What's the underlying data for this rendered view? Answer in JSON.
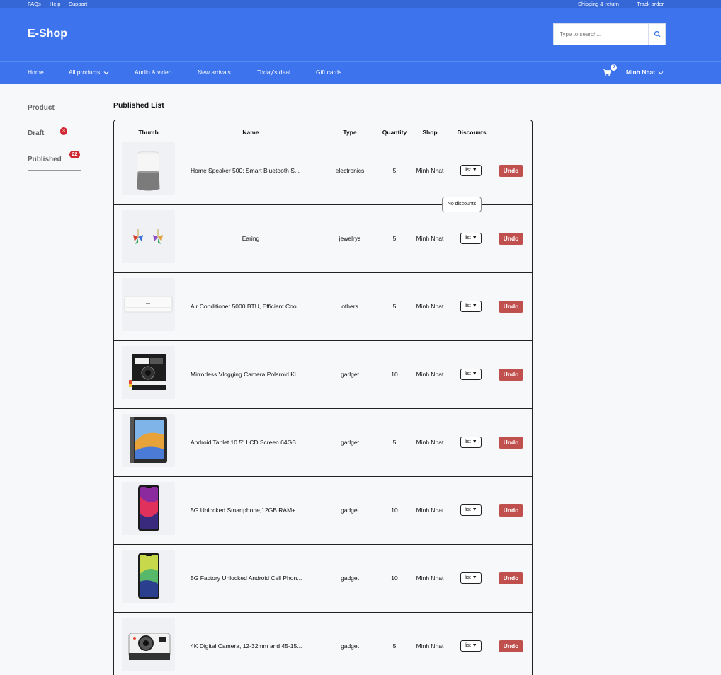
{
  "topbar": {
    "faqs": "FAQs",
    "help": "Help",
    "support": "Support",
    "shipping": "Shipping & return",
    "track": "Track order"
  },
  "header": {
    "logo": "E-Shop",
    "search_placeholder": "Type to search..."
  },
  "nav": {
    "home": "Home",
    "all_products": "All products",
    "audio_video": "Audio & video",
    "new_arrivals": "New arrivals",
    "todays_deal": "Today's deal",
    "gift_cards": "Gift cards",
    "cart_count": "0",
    "user": "Minh Nhat"
  },
  "sidebar": {
    "product": "Product",
    "draft": "Draft",
    "draft_count": "3",
    "published": "Published",
    "published_count": "22"
  },
  "main": {
    "title": "Published List",
    "headers": {
      "thumb": "Thumb",
      "name": "Name",
      "type": "Type",
      "quantity": "Quantity",
      "shop": "Shop",
      "discounts": "Discounts"
    },
    "select_label": "list ▼",
    "undo_label": "Undo",
    "tooltip": "No discounts",
    "rows": [
      {
        "name": "Home Speaker 500: Smart Bluetooth S...",
        "type": "electronics",
        "quantity": "5",
        "shop": "Minh Nhat",
        "thumb": "speaker"
      },
      {
        "name": "Earing",
        "type": "jewelrys",
        "quantity": "5",
        "shop": "Minh Nhat",
        "thumb": "earring"
      },
      {
        "name": "Air Conditioner 5000 BTU, Efficient Coo...",
        "type": "others",
        "quantity": "5",
        "shop": "Minh Nhat",
        "thumb": "aircon"
      },
      {
        "name": "Mirrorless Vlogging Camera Polaroid Ki...",
        "type": "gadget",
        "quantity": "10",
        "shop": "Minh Nhat",
        "thumb": "camera"
      },
      {
        "name": "Android Tablet 10.5\" LCD Screen 64GB...",
        "type": "gadget",
        "quantity": "5",
        "shop": "Minh Nhat",
        "thumb": "tablet"
      },
      {
        "name": "5G Unlocked Smartphone,12GB RAM+...",
        "type": "gadget",
        "quantity": "10",
        "shop": "Minh Nhat",
        "thumb": "phone-purple"
      },
      {
        "name": "5G Factory Unlocked Android Cell Phon...",
        "type": "gadget",
        "quantity": "10",
        "shop": "Minh Nhat",
        "thumb": "phone-green"
      },
      {
        "name": "4K Digital Camera, 12-32mm and 45-15...",
        "type": "gadget",
        "quantity": "5",
        "shop": "Minh Nhat",
        "thumb": "instant-camera"
      }
    ]
  }
}
